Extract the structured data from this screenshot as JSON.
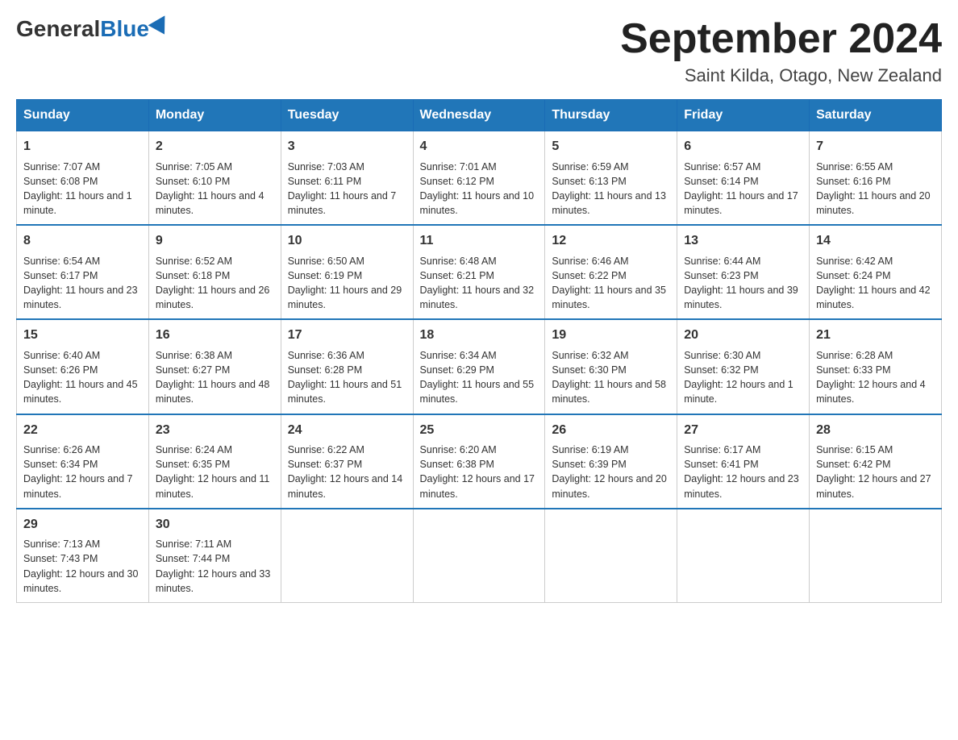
{
  "logo": {
    "general": "General",
    "blue": "Blue"
  },
  "title": "September 2024",
  "subtitle": "Saint Kilda, Otago, New Zealand",
  "days_of_week": [
    "Sunday",
    "Monday",
    "Tuesday",
    "Wednesday",
    "Thursday",
    "Friday",
    "Saturday"
  ],
  "weeks": [
    [
      {
        "day": "1",
        "sunrise": "7:07 AM",
        "sunset": "6:08 PM",
        "daylight": "11 hours and 1 minute."
      },
      {
        "day": "2",
        "sunrise": "7:05 AM",
        "sunset": "6:10 PM",
        "daylight": "11 hours and 4 minutes."
      },
      {
        "day": "3",
        "sunrise": "7:03 AM",
        "sunset": "6:11 PM",
        "daylight": "11 hours and 7 minutes."
      },
      {
        "day": "4",
        "sunrise": "7:01 AM",
        "sunset": "6:12 PM",
        "daylight": "11 hours and 10 minutes."
      },
      {
        "day": "5",
        "sunrise": "6:59 AM",
        "sunset": "6:13 PM",
        "daylight": "11 hours and 13 minutes."
      },
      {
        "day": "6",
        "sunrise": "6:57 AM",
        "sunset": "6:14 PM",
        "daylight": "11 hours and 17 minutes."
      },
      {
        "day": "7",
        "sunrise": "6:55 AM",
        "sunset": "6:16 PM",
        "daylight": "11 hours and 20 minutes."
      }
    ],
    [
      {
        "day": "8",
        "sunrise": "6:54 AM",
        "sunset": "6:17 PM",
        "daylight": "11 hours and 23 minutes."
      },
      {
        "day": "9",
        "sunrise": "6:52 AM",
        "sunset": "6:18 PM",
        "daylight": "11 hours and 26 minutes."
      },
      {
        "day": "10",
        "sunrise": "6:50 AM",
        "sunset": "6:19 PM",
        "daylight": "11 hours and 29 minutes."
      },
      {
        "day": "11",
        "sunrise": "6:48 AM",
        "sunset": "6:21 PM",
        "daylight": "11 hours and 32 minutes."
      },
      {
        "day": "12",
        "sunrise": "6:46 AM",
        "sunset": "6:22 PM",
        "daylight": "11 hours and 35 minutes."
      },
      {
        "day": "13",
        "sunrise": "6:44 AM",
        "sunset": "6:23 PM",
        "daylight": "11 hours and 39 minutes."
      },
      {
        "day": "14",
        "sunrise": "6:42 AM",
        "sunset": "6:24 PM",
        "daylight": "11 hours and 42 minutes."
      }
    ],
    [
      {
        "day": "15",
        "sunrise": "6:40 AM",
        "sunset": "6:26 PM",
        "daylight": "11 hours and 45 minutes."
      },
      {
        "day": "16",
        "sunrise": "6:38 AM",
        "sunset": "6:27 PM",
        "daylight": "11 hours and 48 minutes."
      },
      {
        "day": "17",
        "sunrise": "6:36 AM",
        "sunset": "6:28 PM",
        "daylight": "11 hours and 51 minutes."
      },
      {
        "day": "18",
        "sunrise": "6:34 AM",
        "sunset": "6:29 PM",
        "daylight": "11 hours and 55 minutes."
      },
      {
        "day": "19",
        "sunrise": "6:32 AM",
        "sunset": "6:30 PM",
        "daylight": "11 hours and 58 minutes."
      },
      {
        "day": "20",
        "sunrise": "6:30 AM",
        "sunset": "6:32 PM",
        "daylight": "12 hours and 1 minute."
      },
      {
        "day": "21",
        "sunrise": "6:28 AM",
        "sunset": "6:33 PM",
        "daylight": "12 hours and 4 minutes."
      }
    ],
    [
      {
        "day": "22",
        "sunrise": "6:26 AM",
        "sunset": "6:34 PM",
        "daylight": "12 hours and 7 minutes."
      },
      {
        "day": "23",
        "sunrise": "6:24 AM",
        "sunset": "6:35 PM",
        "daylight": "12 hours and 11 minutes."
      },
      {
        "day": "24",
        "sunrise": "6:22 AM",
        "sunset": "6:37 PM",
        "daylight": "12 hours and 14 minutes."
      },
      {
        "day": "25",
        "sunrise": "6:20 AM",
        "sunset": "6:38 PM",
        "daylight": "12 hours and 17 minutes."
      },
      {
        "day": "26",
        "sunrise": "6:19 AM",
        "sunset": "6:39 PM",
        "daylight": "12 hours and 20 minutes."
      },
      {
        "day": "27",
        "sunrise": "6:17 AM",
        "sunset": "6:41 PM",
        "daylight": "12 hours and 23 minutes."
      },
      {
        "day": "28",
        "sunrise": "6:15 AM",
        "sunset": "6:42 PM",
        "daylight": "12 hours and 27 minutes."
      }
    ],
    [
      {
        "day": "29",
        "sunrise": "7:13 AM",
        "sunset": "7:43 PM",
        "daylight": "12 hours and 30 minutes."
      },
      {
        "day": "30",
        "sunrise": "7:11 AM",
        "sunset": "7:44 PM",
        "daylight": "12 hours and 33 minutes."
      },
      null,
      null,
      null,
      null,
      null
    ]
  ]
}
